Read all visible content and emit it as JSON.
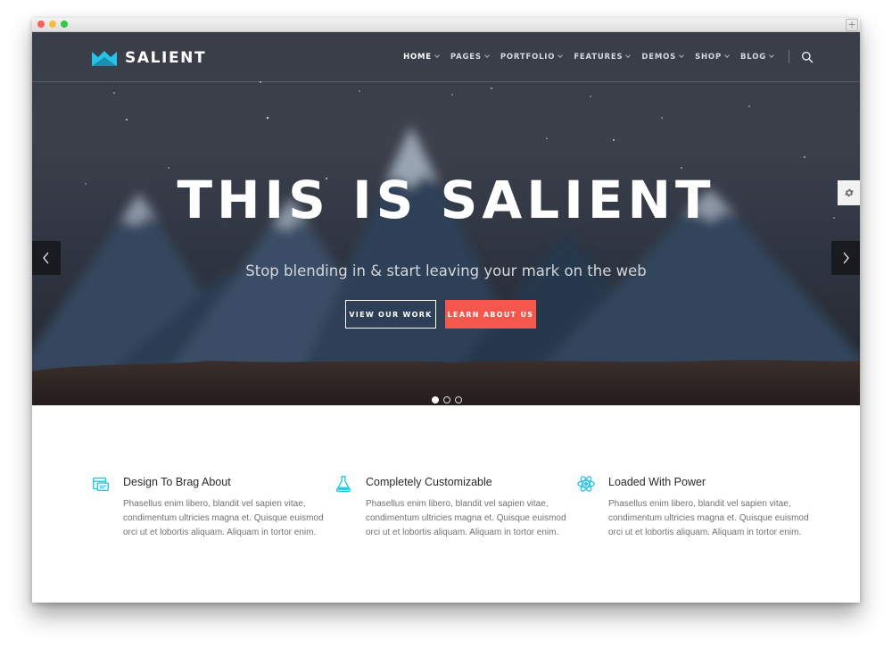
{
  "brand": {
    "name": "SALIENT",
    "accent": "#27c3e6"
  },
  "nav": {
    "items": [
      {
        "label": "HOME",
        "active": true
      },
      {
        "label": "PAGES",
        "active": false
      },
      {
        "label": "PORTFOLIO",
        "active": false
      },
      {
        "label": "FEATURES",
        "active": false
      },
      {
        "label": "DEMOS",
        "active": false
      },
      {
        "label": "SHOP",
        "active": false
      },
      {
        "label": "BLOG",
        "active": false
      }
    ],
    "search_icon": "search-icon"
  },
  "hero": {
    "headline": "THIS IS SALIENT",
    "subheadline": "Stop blending in & start leaving your mark on the web",
    "primary_button": "VIEW OUR WORK",
    "secondary_button": "LEARN ABOUT US",
    "secondary_button_color": "#f5574d",
    "slide_count": 3,
    "active_slide": 1
  },
  "features": [
    {
      "icon": "browser-icon",
      "title": "Design To Brag About",
      "body": "Phasellus enim libero, blandit vel sapien vitae, condimentum ultricies magna et. Quisque euismod orci ut et lobortis aliquam. Aliquam in tortor enim."
    },
    {
      "icon": "flask-icon",
      "title": "Completely Customizable",
      "body": "Phasellus enim libero, blandit vel sapien vitae, condimentum ultricies magna et. Quisque euismod orci ut et lobortis aliquam. Aliquam in tortor enim."
    },
    {
      "icon": "atom-icon",
      "title": "Loaded With Power",
      "body": "Phasellus enim libero, blandit vel sapien vitae, condimentum ultricies magna et. Quisque euismod orci ut et lobortis aliquam. Aliquam in tortor enim."
    }
  ]
}
